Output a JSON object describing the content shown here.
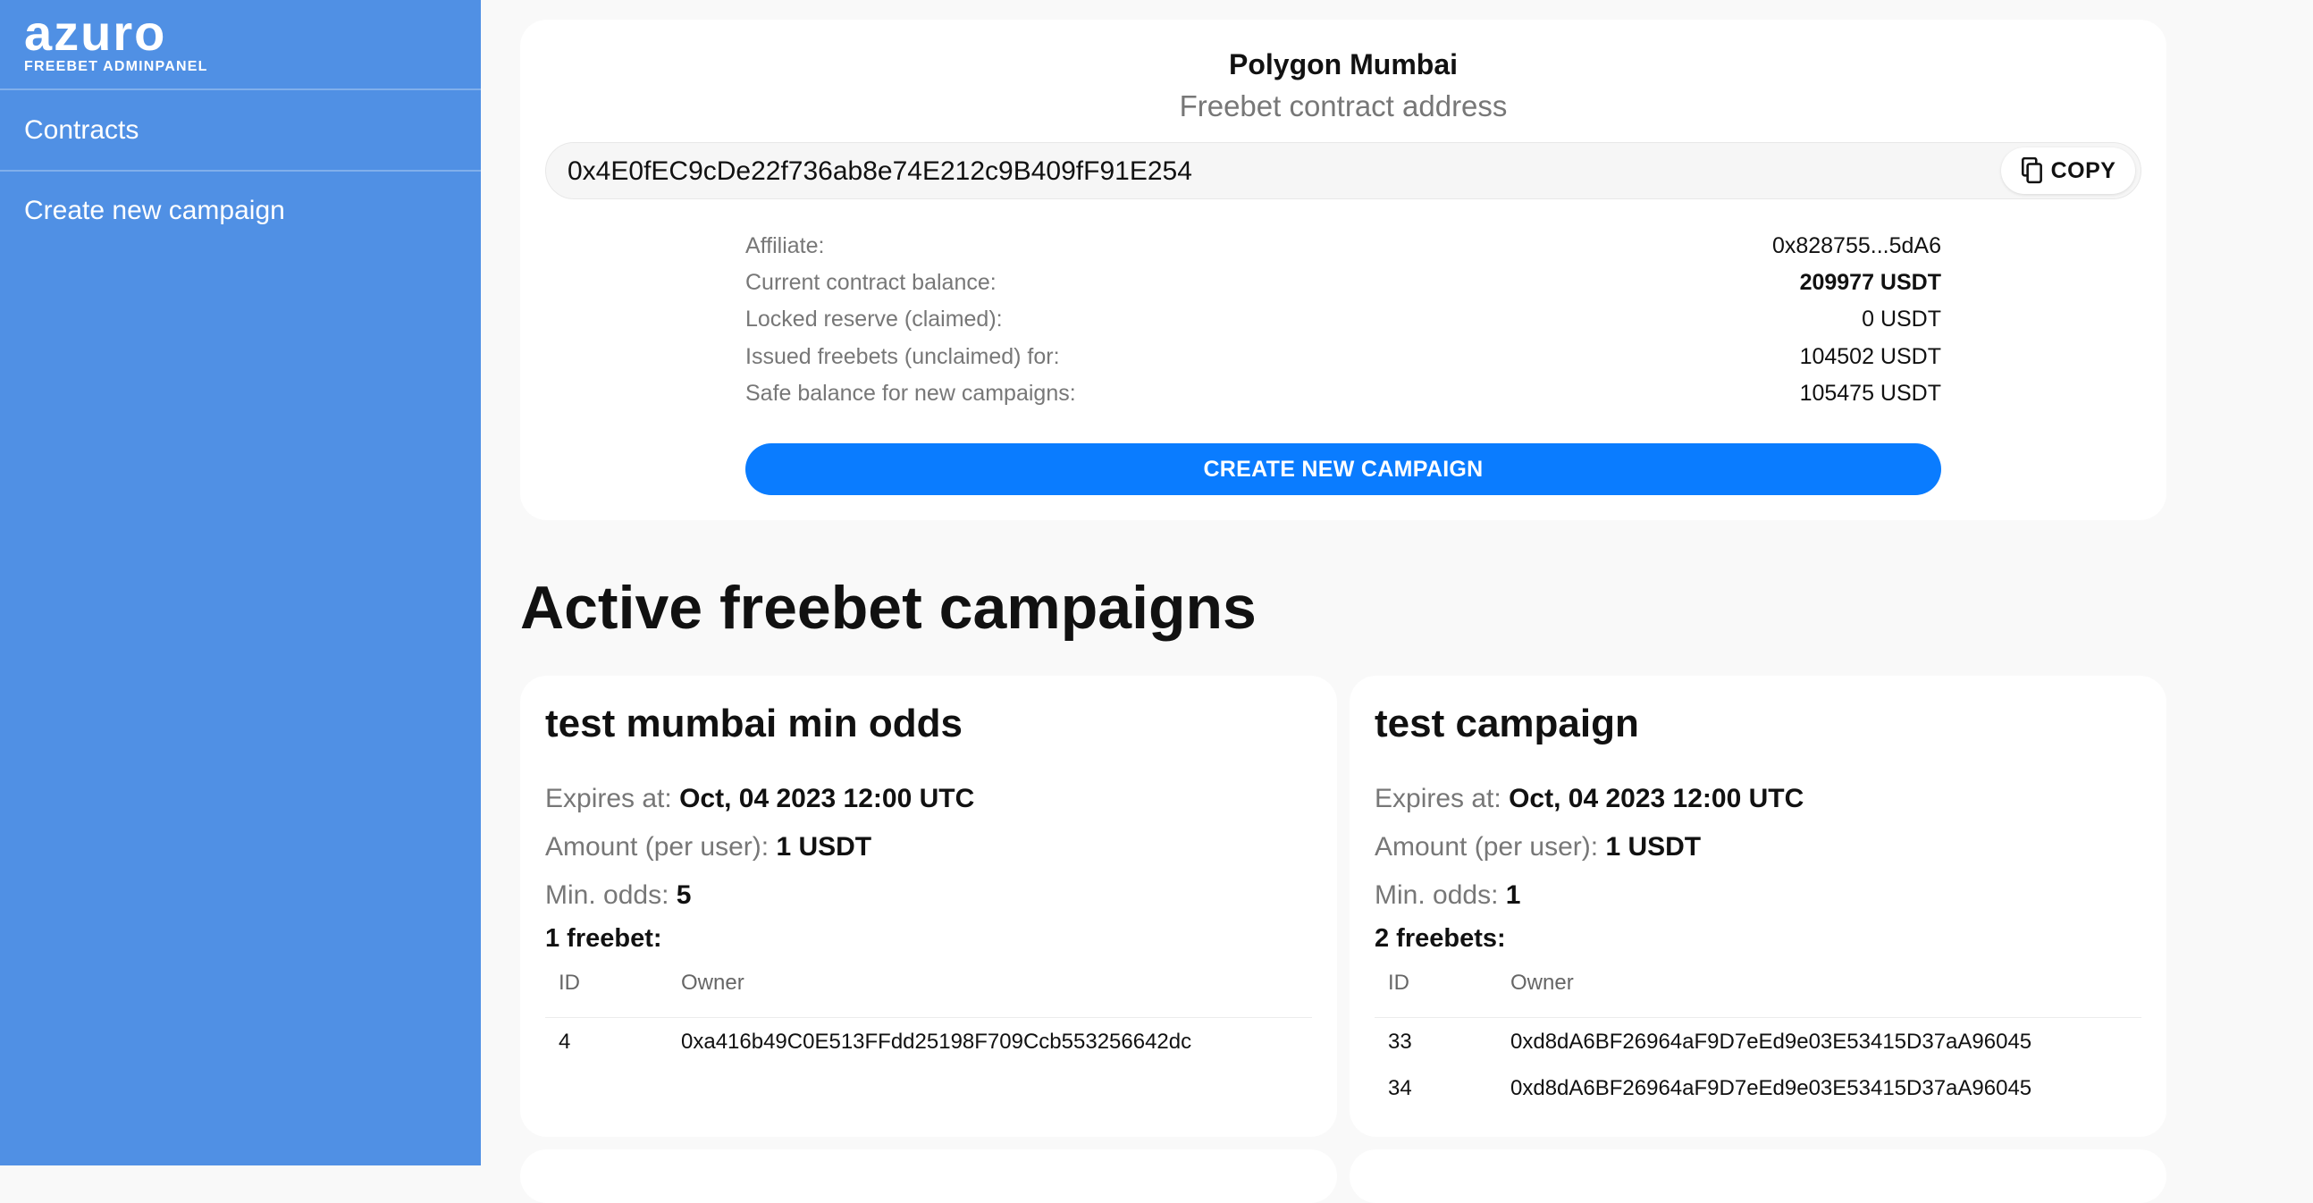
{
  "sidebar": {
    "logo_main": "azuro",
    "logo_sub": "FREEBET ADMINPANEL",
    "items": [
      {
        "label": "Contracts"
      },
      {
        "label": "Create new campaign"
      }
    ]
  },
  "contract": {
    "network": "Polygon Mumbai",
    "subtitle": "Freebet contract address",
    "address": "0x4E0fEC9cDe22f736ab8e74E212c9B409fF91E254",
    "copy_label": "COPY",
    "copy_icon": "copy-icon",
    "info": [
      {
        "label": "Affiliate:",
        "value": "0x828755...5dA6"
      },
      {
        "label": "Current contract balance:",
        "value": "209977 USDT"
      },
      {
        "label": "Locked reserve (claimed):",
        "value": "0 USDT"
      },
      {
        "label": "Issued freebets (unclaimed) for:",
        "value": "104502 USDT"
      },
      {
        "label": "Safe balance for new campaigns:",
        "value": "105475 USDT"
      }
    ],
    "create_button": "CREATE NEW CAMPAIGN"
  },
  "campaigns_title": "Active freebet campaigns",
  "labels": {
    "expires": "Expires at:",
    "amount": "Amount (per user):",
    "min_odds": "Min. odds:",
    "col_id": "ID",
    "col_owner": "Owner"
  },
  "campaigns": [
    {
      "title": "test mumbai min odds",
      "expires": "Oct, 04 2023 12:00 UTC",
      "amount": "1 USDT",
      "min_odds": "5",
      "count_label": "1 freebet:",
      "freebets": [
        {
          "id": "4",
          "owner": "0xa416b49C0E513FFdd25198F709Ccb553256642dc"
        }
      ]
    },
    {
      "title": "test campaign",
      "expires": "Oct, 04 2023 12:00 UTC",
      "amount": "1 USDT",
      "min_odds": "1",
      "count_label": "2 freebets:",
      "freebets": [
        {
          "id": "33",
          "owner": "0xd8dA6BF26964aF9D7eEd9e03E53415D37aA96045"
        },
        {
          "id": "34",
          "owner": "0xd8dA6BF26964aF9D7eEd9e03E53415D37aA96045"
        }
      ]
    }
  ],
  "colors": {
    "sidebar": "#5090e4",
    "primary_button": "#0a7cff",
    "background": "#f9f9f9"
  }
}
